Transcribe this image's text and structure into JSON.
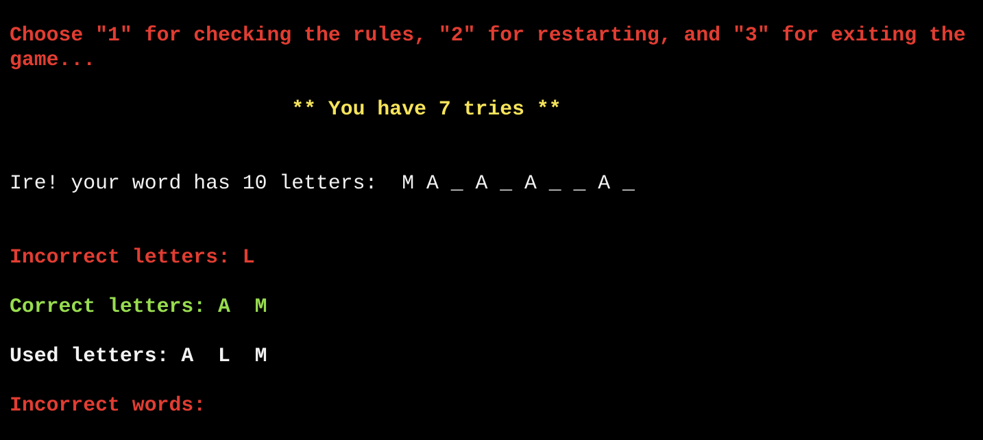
{
  "colors": {
    "red": "#e23d32",
    "yellow": "#f6e45b",
    "green": "#98dc4f",
    "white": "#f2f2f2",
    "background": "#000000"
  },
  "prompt": {
    "line1": "Choose \"1\" for checking the rules, \"2\" for restarting, and \"3\" for exiting the",
    "line2": "game..."
  },
  "tries": "                       ** You have 7 tries **",
  "word": {
    "label": "Ire! your word has 10 letters:  ",
    "pattern": "M A _ A _ A _ _ A _"
  },
  "incorrect_letters": {
    "label": "Incorrect letters: ",
    "value": "L"
  },
  "correct_letters": {
    "label": "Correct letters: ",
    "value": "A  M"
  },
  "used_letters": {
    "label": "Used letters: ",
    "value": "A  L  M"
  },
  "incorrect_words": {
    "label": "Incorrect words:",
    "value": ""
  }
}
